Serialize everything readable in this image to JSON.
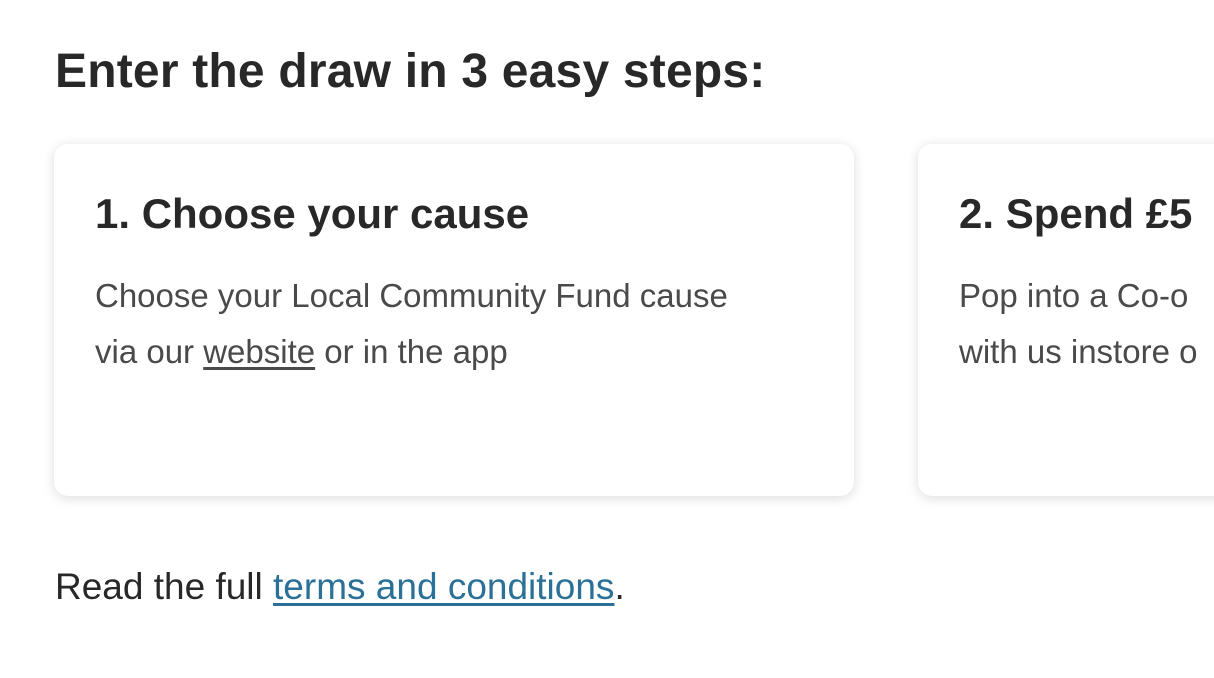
{
  "heading": "Enter the draw in 3 easy steps:",
  "steps": [
    {
      "title": "1. Choose your cause",
      "text_line1": "Choose your Local Community Fund cause",
      "text_line2_before": "via our ",
      "text_line2_link": "website",
      "text_line2_after": " or in the app"
    },
    {
      "title": "2. Spend £5",
      "text_line1": "Pop into a Co-o",
      "text_line2": "with us instore o"
    }
  ],
  "footer": {
    "prefix": "Read the full ",
    "link": "terms and conditions",
    "suffix": "."
  },
  "colors": {
    "text": "#282828",
    "body_text": "#4a4a4a",
    "link": "#2b7197",
    "card_background": "#ffffff"
  }
}
